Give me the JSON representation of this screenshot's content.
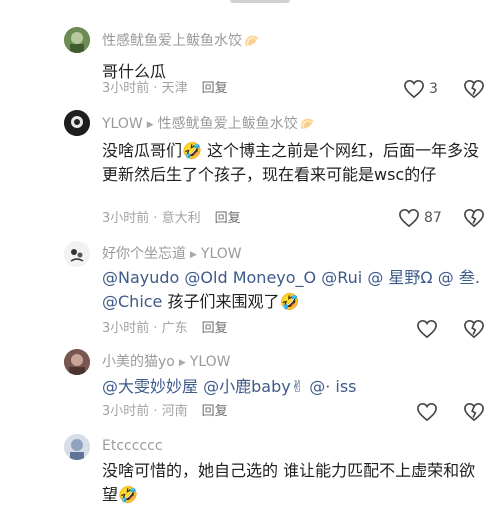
{
  "comments": [
    {
      "author": "性感鱿鱼爱上鲅鱼水饺",
      "author_emoji": "🥟",
      "body": "哥什么瓜",
      "time_location": "3小时前 · 天津",
      "reply_label": "回复",
      "likes": "3"
    },
    {
      "author": "YLOW",
      "reply_to": "性感鱿鱼爱上鲅鱼水饺",
      "reply_to_emoji": "🥟",
      "body": "没啥瓜哥们🤣 这个博主之前是个网红，后面一年多没更新然后生了个孩子，现在看来可能是wsc的仔",
      "time_location": "3小时前 · 意大利",
      "reply_label": "回复",
      "likes": "87"
    },
    {
      "author": "好你个坐忘道",
      "reply_to": "YLOW",
      "mentions": [
        "@Nayudo",
        "@Old Moneyo_O",
        "@Rui",
        "@ 星野Ω",
        "@ 叁.",
        "@Chice"
      ],
      "body_rest": " 孩子们来围观了🤣",
      "time_location": "3小时前 · 广东",
      "reply_label": "回复"
    },
    {
      "author": "小美的猫yo",
      "reply_to": "YLOW",
      "mentions": [
        "@大雯妙妙屋",
        "@小鹿baby✌",
        "@· iss"
      ],
      "time_location": "3小时前 · 河南",
      "reply_label": "回复"
    },
    {
      "author": "Etcccccc",
      "body": "没啥可惜的，她自己选的 谁让能力匹配不上虚荣和欲望🤣"
    }
  ],
  "icons": {
    "like": "heart-icon",
    "dislike": "broken-heart-icon"
  }
}
